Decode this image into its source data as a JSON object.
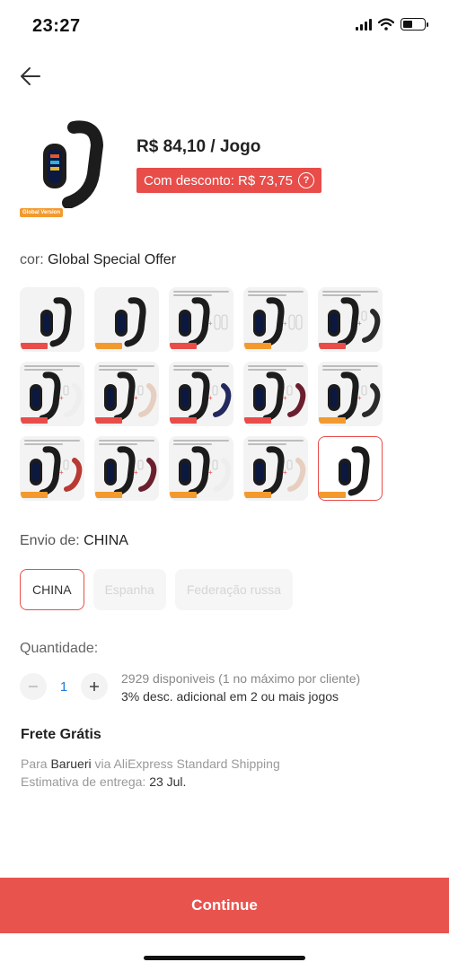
{
  "status_bar": {
    "time": "23:27"
  },
  "product": {
    "price": "R$ 84,10 / Jogo",
    "discount": "Com desconto: R$ 73,75",
    "thumb_tag": "Global Version"
  },
  "color": {
    "label": "cor:",
    "selected": "Global Special Offer",
    "swatches": [
      {
        "variant": "plain",
        "tag": "CN Version"
      },
      {
        "variant": "plain",
        "tag": "Global Version"
      },
      {
        "variant": "film",
        "tag": "CN Version"
      },
      {
        "variant": "film",
        "tag": "Global Version"
      },
      {
        "variant": "strap-black",
        "tag": "CN Version"
      },
      {
        "variant": "strap-white",
        "tag": "CN Version"
      },
      {
        "variant": "strap-pink",
        "tag": "CN Version"
      },
      {
        "variant": "strap-navy",
        "tag": "CN Version"
      },
      {
        "variant": "strap-wine",
        "tag": "CN Version"
      },
      {
        "variant": "strap-black",
        "tag": "Global Version"
      },
      {
        "variant": "strap-red",
        "tag": "Global Version"
      },
      {
        "variant": "strap-wine",
        "tag": "Global Version"
      },
      {
        "variant": "strap-white",
        "tag": "Global Version"
      },
      {
        "variant": "strap-pink",
        "tag": "Global Version"
      },
      {
        "variant": "plain",
        "tag": "Global Version",
        "selected": true
      }
    ]
  },
  "shipping_from": {
    "label": "Envio de:",
    "value": "CHINA",
    "options": [
      "CHINA",
      "Espanha",
      "Federação russa"
    ]
  },
  "quantity": {
    "label": "Quantidade:",
    "value": "1",
    "stock": "2929 disponiveis (1 no máximo por cliente)",
    "extra_discount": "3% desc. adicional em 2 ou mais jogos"
  },
  "shipping": {
    "title": "Frete Grátis",
    "to_prefix": "Para",
    "city": "Barueri",
    "via": "via AliExpress Standard Shipping",
    "estimate_label": "Estimativa de entrega:",
    "estimate_date": "23 Jul."
  },
  "actions": {
    "continue": "Continue"
  },
  "colors": {
    "accent": "#e84d4a",
    "tag_orange": "#f39a2e",
    "link_blue": "#1f7ae0"
  }
}
